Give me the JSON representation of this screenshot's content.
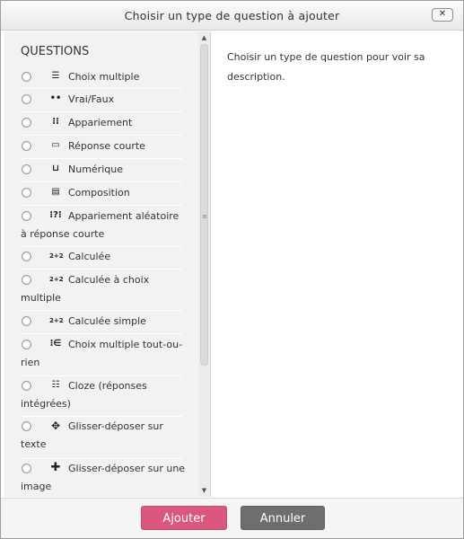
{
  "dialog": {
    "title": "Choisir un type de question à ajouter",
    "close_label": "✕"
  },
  "questions": {
    "section_title": "QUESTIONS",
    "items": [
      {
        "label1": "Choix multiple",
        "label2": "",
        "icon": "☰"
      },
      {
        "label1": "Vrai/Faux",
        "label2": "",
        "icon": "••"
      },
      {
        "label1": "Appariement",
        "label2": "",
        "icon": "⁝⁝"
      },
      {
        "label1": "Réponse courte",
        "label2": "",
        "icon": "▭"
      },
      {
        "label1": "Numérique",
        "label2": "",
        "icon": "⊔"
      },
      {
        "label1": "Composition",
        "label2": "",
        "icon": "▤"
      },
      {
        "label1": "Appariement aléatoire",
        "label2": "à réponse courte",
        "icon": "⁝?⁝"
      },
      {
        "label1": "Calculée",
        "label2": "",
        "icon": "2+2"
      },
      {
        "label1": "Calculée à choix",
        "label2": "multiple",
        "icon": "2+2"
      },
      {
        "label1": "Calculée simple",
        "label2": "",
        "icon": "2+2"
      },
      {
        "label1": "Choix multiple tout-ou-",
        "label2": "rien",
        "icon": "⁝∈"
      },
      {
        "label1": "Cloze (réponses",
        "label2": "intégrées)",
        "icon": "☷"
      },
      {
        "label1": "Glisser-déposer sur",
        "label2": "texte",
        "icon": "✥"
      },
      {
        "label1": "Glisser-déposer sur une",
        "label2": "image",
        "icon": "✚"
      }
    ]
  },
  "description_text": "Choisir un type de question pour voir sa description.",
  "scrollbar": {
    "up": "▲",
    "down": "▼",
    "grip": "≡"
  },
  "footer": {
    "add_label": "Ajouter",
    "cancel_label": "Annuler"
  }
}
